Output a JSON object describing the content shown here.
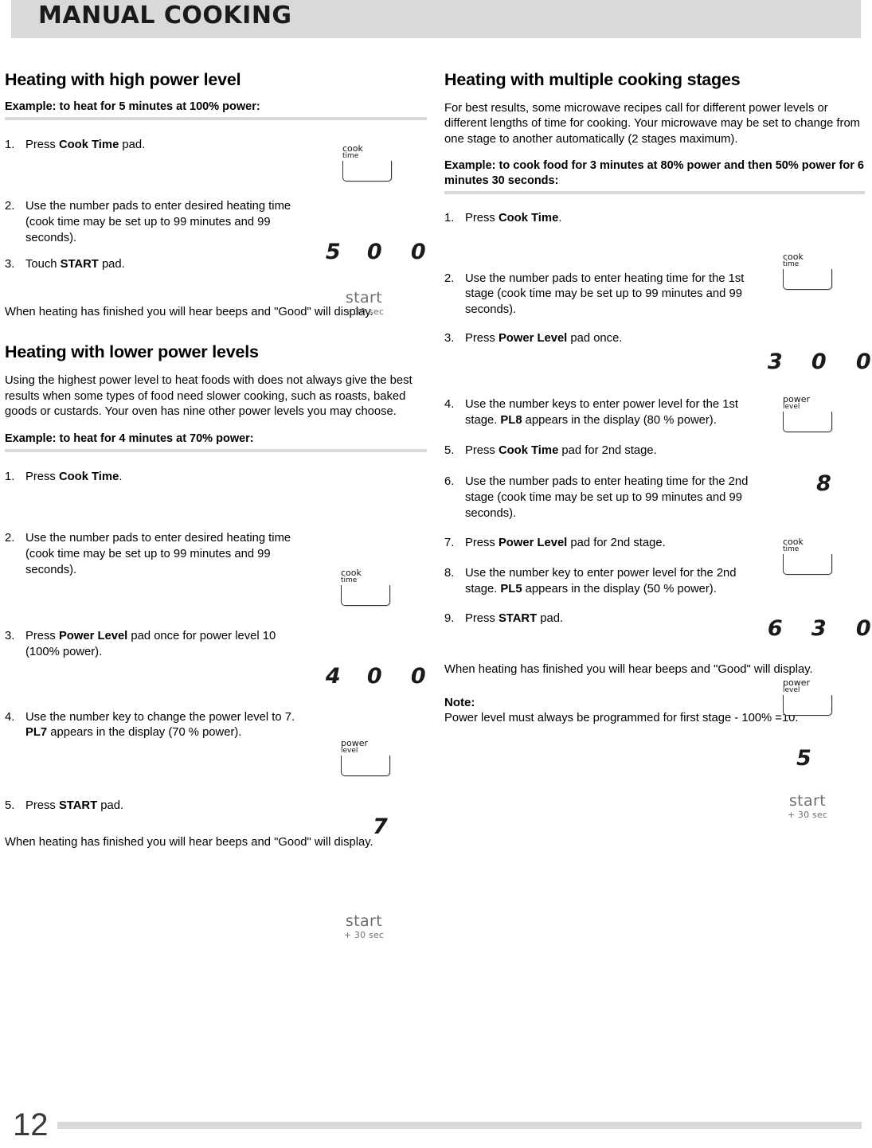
{
  "header": {
    "title": "MANUAL COOKING"
  },
  "page": {
    "number": "12"
  },
  "left": {
    "section1": {
      "heading": "Heating with high power level",
      "example": "Example: to heat for 5 minutes at 100% power:",
      "steps": [
        {
          "num": "1.",
          "html": "Press <b>Cook Time</b> pad."
        },
        {
          "num": "2.",
          "html": "Use the number pads to enter desired heating time (cook time may be set up to 99 minutes and 99 seconds)."
        },
        {
          "num": "3.",
          "html": "Touch <b>START</b> pad."
        }
      ],
      "closing": "When heating has finished you will hear beeps and \"Good\" will display.",
      "digits": "5 0 0"
    },
    "section2": {
      "heading": "Heating with lower power levels",
      "intro": "Using the highest power level to heat foods with does not always give the best results when some types of food need slower cooking, such as roasts, baked goods or custards. Your oven has nine other power levels you may choose.",
      "example": "Example: to heat for 4 minutes at 70% power:",
      "steps": [
        {
          "num": "1.",
          "html": "Press <b>Cook Time</b>."
        },
        {
          "num": "2.",
          "html": "Use the number pads to enter desired heating time (cook time may be set up to 99 minutes and 99 seconds)."
        },
        {
          "num": "3.",
          "html": "Press <b>Power Level</b> pad once for power level 10 (100% power)."
        },
        {
          "num": "4.",
          "html": "Use the number key to change the power level to 7. <b>PL7</b> appears in the display (70 % power)."
        },
        {
          "num": "5.",
          "html": "Press <b>START</b> pad."
        }
      ],
      "closing": "When heating has finished you will hear beeps and \"Good\" will display.",
      "digits_time": "4 0 0",
      "digit_power": "7"
    }
  },
  "right": {
    "heading": "Heating with multiple cooking stages",
    "intro": "For best results, some microwave recipes call for different power levels or different lengths of time for cooking. Your microwave may be set to change from one stage to another automatically (2 stages maximum).",
    "example": "Example: to cook food for 3 minutes at 80% power and then 50% power for 6 minutes 30 seconds:",
    "steps": [
      {
        "num": "1.",
        "html": "Press <b>Cook Time</b>."
      },
      {
        "num": "2.",
        "html": "Use the number pads to enter heating time for the 1st stage (cook time may be set up to 99 minutes and 99 seconds)."
      },
      {
        "num": "3.",
        "html": "Press <b>Power Level</b> pad once."
      },
      {
        "num": "4.",
        "html": "Use the number keys to enter power level for the 1st stage. <b>PL8</b> appears in the display (80 % power)."
      },
      {
        "num": "5.",
        "html": "Press <b>Cook Time</b> pad for 2nd stage."
      },
      {
        "num": "6.",
        "html": "Use the number pads to enter heating time for the 2nd stage (cook time may be set up to 99 minutes and 99 seconds)."
      },
      {
        "num": "7.",
        "html": "Press <b>Power Level</b> pad for 2nd stage."
      },
      {
        "num": "8.",
        "html": "Use the number key to enter power level for the 2nd stage. <b>PL5</b> appears in the display (50 % power)."
      },
      {
        "num": "9.",
        "html": "Press <b>START</b> pad."
      }
    ],
    "closing": "When heating has finished you will hear beeps and \"Good\" will display.",
    "note_title": "Note:",
    "note_body": "     Power level must always be programmed for first stage - 100% =10.",
    "digits_stage1_time": "3 0 0",
    "digit_stage1_power": "8",
    "digits_stage2_time": "6 3 0",
    "digit_stage2_power": "5"
  },
  "keys": {
    "cook": {
      "line1": "cook",
      "line2": "time"
    },
    "power": {
      "line1": "power",
      "line2": "level"
    },
    "start": {
      "word": "start",
      "sub": "+ 30 sec"
    }
  }
}
